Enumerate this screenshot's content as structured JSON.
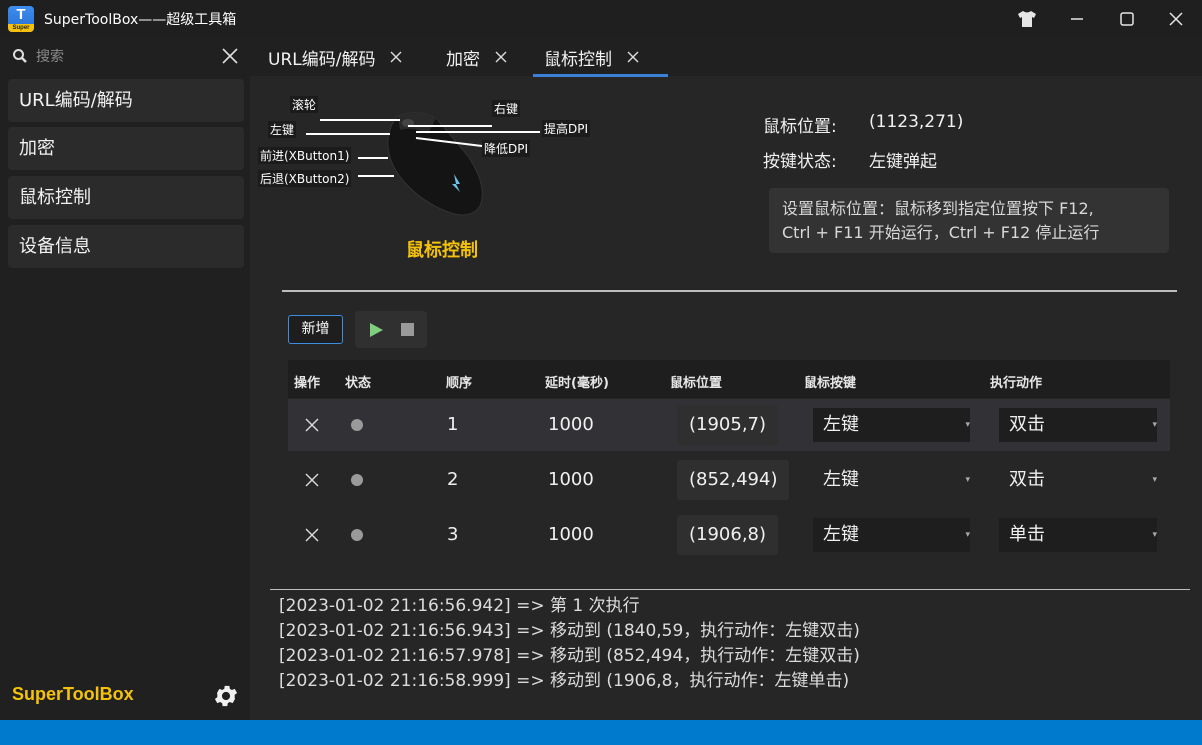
{
  "app": {
    "title": "SuperToolBox——超级工具箱",
    "logo_top": "T",
    "logo_bottom": "Super",
    "brand": "SuperToolBox"
  },
  "window_controls": [
    "skin-icon",
    "minimize-icon",
    "maximize-icon",
    "close-icon"
  ],
  "sidebar": {
    "search_placeholder": "搜索",
    "items": [
      {
        "label": "URL编码/解码"
      },
      {
        "label": "加密"
      },
      {
        "label": "鼠标控制"
      },
      {
        "label": "设备信息"
      }
    ]
  },
  "tabs": [
    {
      "label": "URL编码/解码"
    },
    {
      "label": "加密"
    },
    {
      "label": "鼠标控制",
      "active": true
    }
  ],
  "mouse_diagram": {
    "caption": "鼠标控制",
    "labels": {
      "wheel": "滚轮",
      "left": "左键",
      "right": "右键",
      "dpi_up": "提高DPI",
      "dpi_down": "降低DPI",
      "forward": "前进(XButton1)",
      "back": "后退(XButton2)"
    }
  },
  "info": {
    "position_label": "鼠标位置:",
    "position_value": "(1123,271)",
    "state_label": "按键状态:",
    "state_value": "左键弹起",
    "hint_line1": "设置鼠标位置：鼠标移到指定位置按下 F12,",
    "hint_line2": "Ctrl + F11 开始运行，Ctrl + F12 停止运行"
  },
  "toolbar": {
    "add_label": "新增"
  },
  "grid": {
    "headers": {
      "op": "操作",
      "status": "状态",
      "order": "顺序",
      "delay": "延时(毫秒)",
      "pos": "鼠标位置",
      "button": "鼠标按键",
      "action": "执行动作"
    },
    "rows": [
      {
        "order": "1",
        "delay": "1000",
        "pos": "(1905,7)",
        "button": "左键",
        "action": "双击"
      },
      {
        "order": "2",
        "delay": "1000",
        "pos": "(852,494)",
        "button": "左键",
        "action": "双击"
      },
      {
        "order": "3",
        "delay": "1000",
        "pos": "(1906,8)",
        "button": "左键",
        "action": "单击"
      }
    ]
  },
  "log": [
    "[2023-01-02 21:16:56.942] => 第 1 次执行",
    "[2023-01-02 21:16:56.943] => 移动到 (1840,59，执行动作：左键双击)",
    "[2023-01-02 21:16:57.978] => 移动到 (852,494，执行动作：左键双击)",
    "[2023-01-02 21:16:58.999] => 移动到 (1906,8，执行动作：左键单击)"
  ],
  "colors": {
    "accent": "#3b82d6",
    "brand": "#f4c20d",
    "statusbar": "#007acc"
  }
}
